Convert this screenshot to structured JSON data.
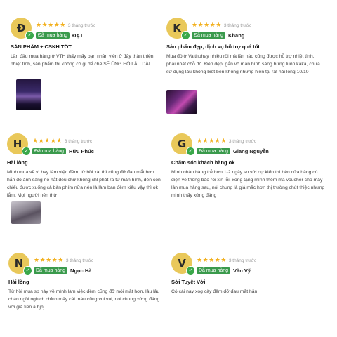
{
  "reviews": [
    {
      "initial": "Đ",
      "rating": "★★★★★",
      "time": "3 tháng trước",
      "badge": "Đã mua hàng",
      "name": "ĐẠT",
      "title": "SẢN PHẨM + CSKH TỐT",
      "body": "Lần đầu mua hàng ở VTH thấy mấy bạn nhân viên ở đây thân thiện, nhiệt tình, sản phẩm thì không có gì để chê SẼ ỦNG HỘ LÂU DÀI"
    },
    {
      "initial": "K",
      "rating": "★★★★★",
      "time": "3 tháng trước",
      "badge": "Đã mua hàng",
      "name": "Khang",
      "title": "Sản phẩm đẹp, dịch vụ hỗ trợ quá tốt",
      "body": "Mua đồ ở Vaithuhay nhiều rồi mà lần nào cũng được hỗ trợ nhiệt tình, phải nhất chỗ đó. Đèn đẹp, gắn vô màn hình sáng bừng luôn kaka, chưa sử dụng lâu không biết bền không nhưng hiện tại rất hài lòng 10/10"
    },
    {
      "initial": "H",
      "rating": "★★★★★",
      "time": "3 tháng trước",
      "badge": "Đã mua hàng",
      "name": "Hữu Phúc",
      "title": "Hài lòng",
      "body": "Mình mua về vì hay làm việc đêm, từ hồi xài thì cũng đỡ đau mắt hơn hẳn do ánh sáng nó hắt đều chứ không chỉ phát ra từ màn hình, đèn còn chiếu được xuống cả bàn phím nữa nên là làm ban đêm kiểu vậy thì ok lắm. Mọi người nên thử"
    },
    {
      "initial": "G",
      "rating": "★★★★★",
      "time": "3 tháng trước",
      "badge": "Đã mua hàng",
      "name": "Giang Nguyễn",
      "title": "Chăm sóc khách hàng ok",
      "body": "Mình nhận hàng trễ hơn 1-2 ngày so với dự kiến thì bên cửa hàng có điện về thông báo rồi xin lỗi, xong tặng mình thêm mã voucher cho mấy lần mua hàng sau, nói chung là giá mắc hơn thị trường chút thiệc nhưng mình thấy xứng đáng"
    },
    {
      "initial": "N",
      "rating": "★★★★★",
      "time": "3 tháng trước",
      "badge": "Đã mua hàng",
      "name": "Ngọc Hà",
      "title": "Hài lòng",
      "body": "Từ hồi mua sp này về mình làm việc đêm cũng đỡ mỏi mắt hơn, lâu lâu chán ngồi nghịch chỉnh mấy cái màu cũng vui vui, nói chung xứng đáng với giá tiền á hjhj"
    },
    {
      "initial": "V",
      "rating": "★★★★★",
      "time": "3 tháng trước",
      "badge": "Đã mua hàng",
      "name": "Văn Vỹ",
      "title": "Sời Tuyệt Vời",
      "body": "Có cái này xog cày đêm đỡ đau mắt hẳn"
    }
  ],
  "colors": {
    "star": "#f2b01e",
    "badge": "#3a9a4c",
    "avatar": "#e9c85a"
  },
  "icons": {
    "verified": "check-icon"
  }
}
